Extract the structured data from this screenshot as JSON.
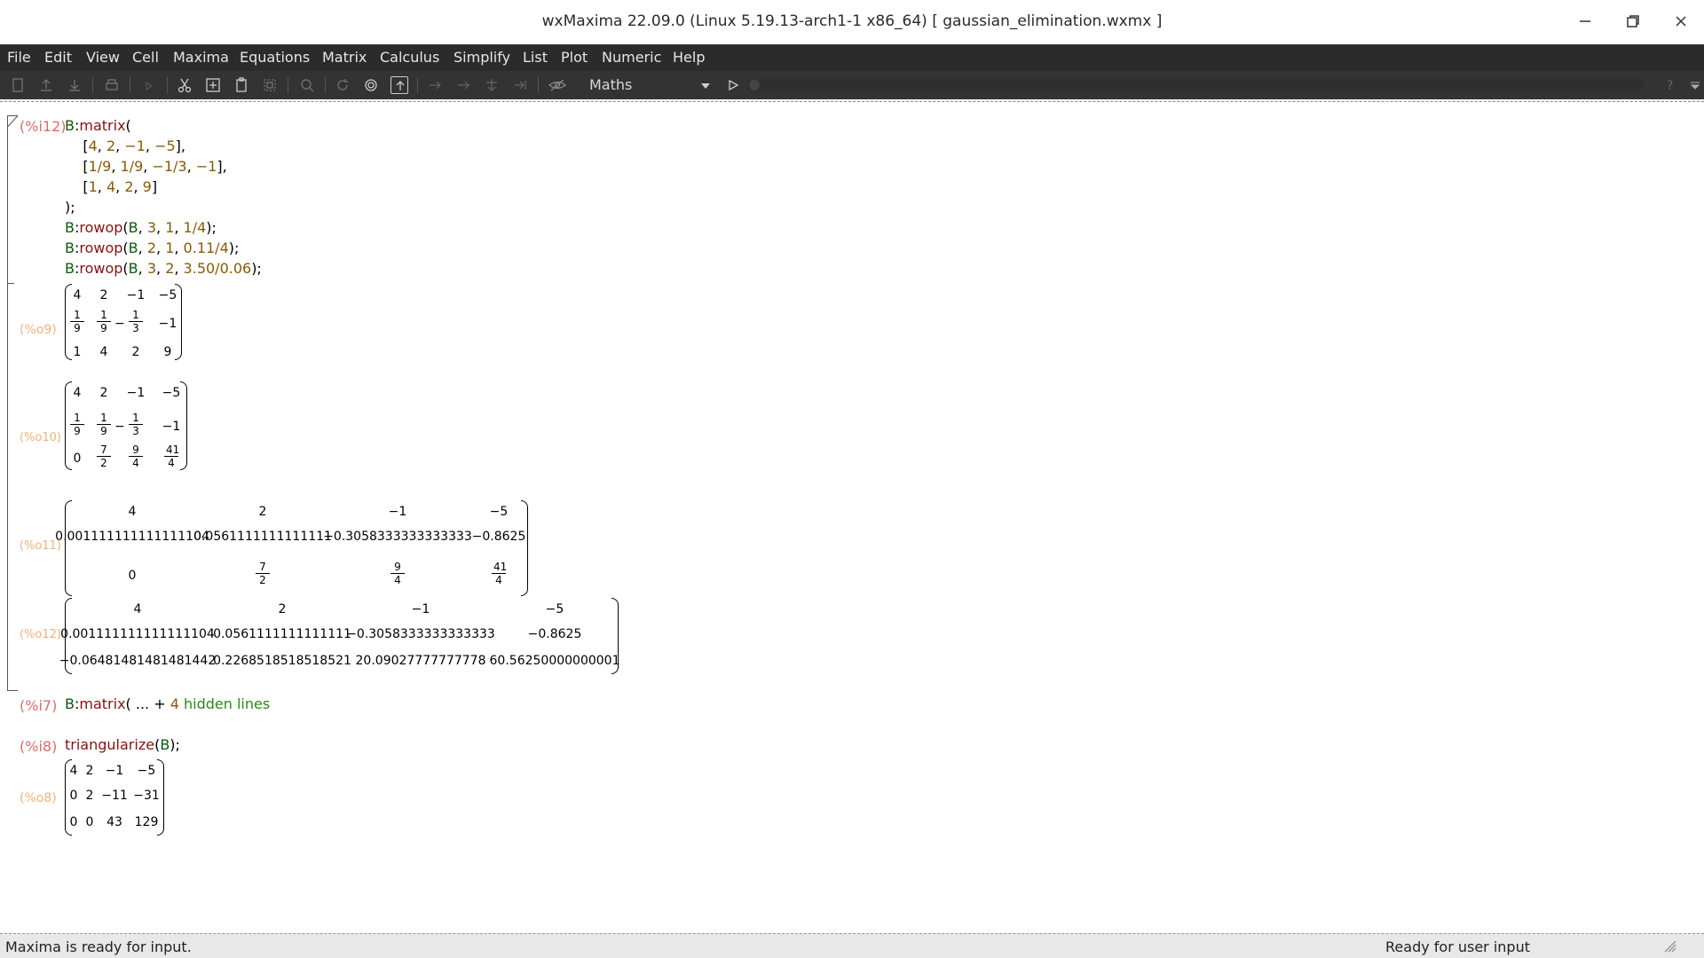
{
  "window": {
    "title": "wxMaxima 22.09.0 (Linux 5.19.13-arch1-1 x86_64) [ gaussian_elimination.wxmx ]"
  },
  "menu": [
    "File",
    "Edit",
    "View",
    "Cell",
    "Maxima",
    "Equations",
    "Matrix",
    "Calculus",
    "Simplify",
    "List",
    "Plot",
    "Numeric",
    "Help"
  ],
  "toolbar": {
    "mode": "Maths",
    "icons": [
      "new-file-icon",
      "open-icon",
      "save-icon",
      "print-icon",
      "zoom-icon",
      "cut-icon",
      "copy-icon",
      "paste-icon",
      "select-all-icon",
      "find-icon",
      "restart-icon",
      "interrupt-icon",
      "follow-icon",
      "eval-icon",
      "eval-next-icon",
      "eval-section-icon",
      "eval-all-icon",
      "hide-code-icon",
      "play-icon",
      "help-icon",
      "menu-icon"
    ]
  },
  "cells": {
    "i12": {
      "label": "(%i12)",
      "lines": [
        {
          "parts": [
            [
              "var",
              "B"
            ],
            [
              "p",
              ":"
            ],
            [
              "fn",
              "matrix"
            ],
            [
              "p",
              "("
            ]
          ]
        },
        {
          "parts": [
            [
              "p",
              "    ["
            ],
            [
              "num",
              "4"
            ],
            [
              "p",
              ", "
            ],
            [
              "num",
              "2"
            ],
            [
              "p",
              ", "
            ],
            [
              "num",
              "−1"
            ],
            [
              "p",
              ", "
            ],
            [
              "num",
              "−5"
            ],
            [
              "p",
              "],"
            ]
          ]
        },
        {
          "parts": [
            [
              "p",
              "    ["
            ],
            [
              "num",
              "1/9"
            ],
            [
              "p",
              ", "
            ],
            [
              "num",
              "1/9"
            ],
            [
              "p",
              ", "
            ],
            [
              "num",
              "−1/3"
            ],
            [
              "p",
              ", "
            ],
            [
              "num",
              "−1"
            ],
            [
              "p",
              "],"
            ]
          ]
        },
        {
          "parts": [
            [
              "p",
              "    ["
            ],
            [
              "num",
              "1"
            ],
            [
              "p",
              ", "
            ],
            [
              "num",
              "4"
            ],
            [
              "p",
              ", "
            ],
            [
              "num",
              "2"
            ],
            [
              "p",
              ", "
            ],
            [
              "num",
              "9"
            ],
            [
              "p",
              "]"
            ]
          ]
        },
        {
          "parts": [
            [
              "p",
              ");"
            ]
          ]
        },
        {
          "parts": [
            [
              "var",
              "B"
            ],
            [
              "p",
              ":"
            ],
            [
              "fn",
              "rowop"
            ],
            [
              "p",
              "("
            ],
            [
              "var",
              "B"
            ],
            [
              "p",
              ", "
            ],
            [
              "num",
              "3"
            ],
            [
              "p",
              ", "
            ],
            [
              "num",
              "1"
            ],
            [
              "p",
              ", "
            ],
            [
              "num",
              "1/4"
            ],
            [
              "p",
              ");"
            ]
          ]
        },
        {
          "parts": [
            [
              "var",
              "B"
            ],
            [
              "p",
              ":"
            ],
            [
              "fn",
              "rowop"
            ],
            [
              "p",
              "("
            ],
            [
              "var",
              "B"
            ],
            [
              "p",
              ", "
            ],
            [
              "num",
              "2"
            ],
            [
              "p",
              ", "
            ],
            [
              "num",
              "1"
            ],
            [
              "p",
              ", "
            ],
            [
              "num",
              "0.11/4"
            ],
            [
              "p",
              ");"
            ]
          ]
        },
        {
          "parts": [
            [
              "var",
              "B"
            ],
            [
              "p",
              ":"
            ],
            [
              "fn",
              "rowop"
            ],
            [
              "p",
              "("
            ],
            [
              "var",
              "B"
            ],
            [
              "p",
              ", "
            ],
            [
              "num",
              "3"
            ],
            [
              "p",
              ", "
            ],
            [
              "num",
              "2"
            ],
            [
              "p",
              ", "
            ],
            [
              "num",
              "3.50/0.06"
            ],
            [
              "p",
              ");"
            ]
          ]
        }
      ]
    },
    "o9": {
      "label": "(%o9)",
      "rows": [
        [
          "4",
          "2",
          "−1",
          "−5"
        ],
        [
          "1/9",
          "1/9",
          "−1/3",
          "−1"
        ],
        [
          "1",
          "4",
          "2",
          "9"
        ]
      ]
    },
    "o10": {
      "label": "(%o10)",
      "rows": [
        [
          "4",
          "2",
          "−1",
          "−5"
        ],
        [
          "1/9",
          "1/9",
          "−1/3",
          "−1"
        ],
        [
          "0",
          "7/2",
          "9/4",
          "41/4"
        ]
      ]
    },
    "o11": {
      "label": "(%o11)",
      "rows": [
        [
          "4",
          "2",
          "−1",
          "−5"
        ],
        [
          "0.001111111111111104",
          "0.0561111111111111",
          "−0.3058333333333333",
          "−0.8625"
        ],
        [
          "0",
          "7/2",
          "9/4",
          "41/4"
        ]
      ]
    },
    "o12": {
      "label": "(%o12)",
      "rows": [
        [
          "4",
          "2",
          "−1",
          "−5"
        ],
        [
          "0.001111111111111104",
          "0.0561111111111111",
          "−0.3058333333333333",
          "−0.8625"
        ],
        [
          "−0.06481481481481442",
          "0.2268518518518521",
          "20.09027777777778",
          "60.56250000000001"
        ]
      ]
    },
    "i7": {
      "label": "(%i7)",
      "code": "B:matrix( ... + ",
      "hidden_count": "4",
      "hidden_text": "hidden lines"
    },
    "i8": {
      "label": "(%i8)",
      "fn": "triangularize",
      "arg": "B",
      "open": "(",
      "close": ");"
    },
    "o8": {
      "label": "(%o8)",
      "rows": [
        [
          "4",
          "2",
          "−1",
          "−5"
        ],
        [
          "0",
          "2",
          "−11",
          "−31"
        ],
        [
          "0",
          "0",
          "43",
          "129"
        ]
      ]
    }
  },
  "status": {
    "left": "Maxima is ready for input.",
    "right": "Ready for user input"
  },
  "colors": {
    "menubar": "#2b2b2b",
    "toolbar": "#333333",
    "input_label": "#e06a6a",
    "output_label": "#f3b27a",
    "function": "#8a1010",
    "variable": "#0a5a0a",
    "number": "#8a5a00"
  }
}
